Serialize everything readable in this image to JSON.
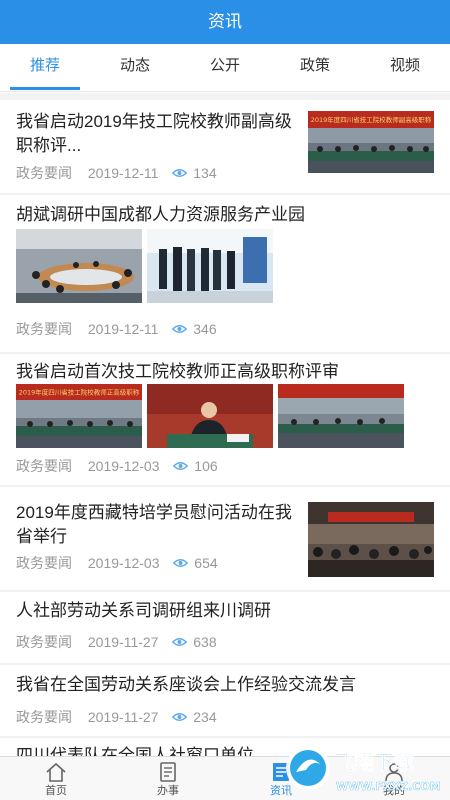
{
  "header": {
    "title": "资讯"
  },
  "tabs": [
    {
      "label": "推荐",
      "active": true
    },
    {
      "label": "动态",
      "active": false
    },
    {
      "label": "公开",
      "active": false
    },
    {
      "label": "政策",
      "active": false
    },
    {
      "label": "视频",
      "active": false
    }
  ],
  "feed": [
    {
      "title": "我省启动2019年技工院校教师副高级职称评...",
      "source": "政务要闻",
      "date": "2019-12-11",
      "views": "134",
      "banner_text": "2019年度四川省技工院校教师副高级职称"
    },
    {
      "title": "胡斌调研中国成都人力资源服务产业园",
      "source": "政务要闻",
      "date": "2019-12-11",
      "views": "346"
    },
    {
      "title": "我省启动首次技工院校教师正高级职称评审",
      "source": "政务要闻",
      "date": "2019-12-03",
      "views": "106",
      "banner_text": "2019年度四川省技工院校教师正高级职称"
    },
    {
      "title": "2019年度西藏特培学员慰问活动在我省举行",
      "source": "政务要闻",
      "date": "2019-12-03",
      "views": "654"
    },
    {
      "title": "人社部劳动关系司调研组来川调研",
      "source": "政务要闻",
      "date": "2019-11-27",
      "views": "638"
    },
    {
      "title": "我省在全国劳动关系座谈会上作经验交流发言",
      "source": "政务要闻",
      "date": "2019-11-27",
      "views": "234"
    },
    {
      "title": "四川代表队在全国人社窗口单位..."
    }
  ],
  "tabbar": [
    {
      "label": "首页",
      "icon": "home-icon"
    },
    {
      "label": "办事",
      "icon": "document-icon"
    },
    {
      "label": "资讯",
      "icon": "news-icon",
      "active": true
    },
    {
      "label": "我的",
      "icon": "user-icon"
    }
  ],
  "watermark": {
    "brand": "飞翔下载",
    "url": "WWW.FXXZ.COM"
  },
  "colors": {
    "primary": "#2a8fe6",
    "meta": "#999999",
    "divider": "#f2f2f2"
  }
}
